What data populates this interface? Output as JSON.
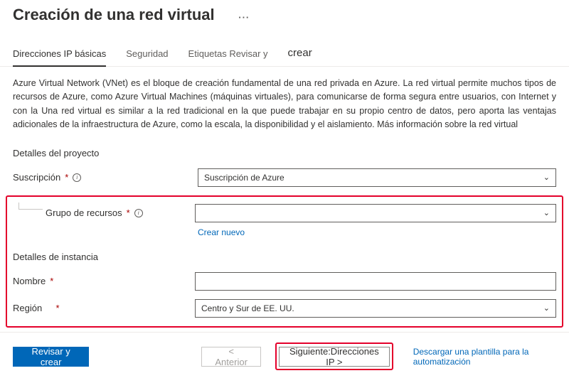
{
  "header": {
    "title": "Creación de una red virtual",
    "ellipsis": "···"
  },
  "tabs": {
    "basics": "Direcciones IP básicas",
    "security": "Seguridad",
    "tags_review": "Etiquetas Revisar y",
    "create": "crear"
  },
  "description": "Azure Virtual Network (VNet) es el bloque de creación fundamental de una red privada en Azure. La red virtual permite muchos tipos de recursos de Azure, como Azure Virtual Machines (máquinas virtuales), para comunicarse de forma segura entre usuarios, con Internet y con la Una red virtual es similar a la red tradicional en la que puede trabajar en su propio centro de datos, pero aporta las ventajas adicionales de la infraestructura de Azure, como la escala, la disponibilidad y el aislamiento. Más información sobre la red virtual",
  "sections": {
    "project": "Detalles del proyecto",
    "instance": "Detalles de instancia"
  },
  "fields": {
    "subscription": {
      "label": "Suscripción",
      "value": "Suscripción de Azure"
    },
    "resourceGroup": {
      "label": "Grupo de recursos",
      "value": "",
      "createNew": "Crear nuevo"
    },
    "name": {
      "label": "Nombre",
      "value": ""
    },
    "region": {
      "label": "Región",
      "value": "Centro y Sur de EE. UU."
    }
  },
  "footer": {
    "review": "Revisar y   crear",
    "previous": "<  Anterior",
    "next": "Siguiente:Direcciones IP  >",
    "download": "Descargar una plantilla para la automatización"
  }
}
